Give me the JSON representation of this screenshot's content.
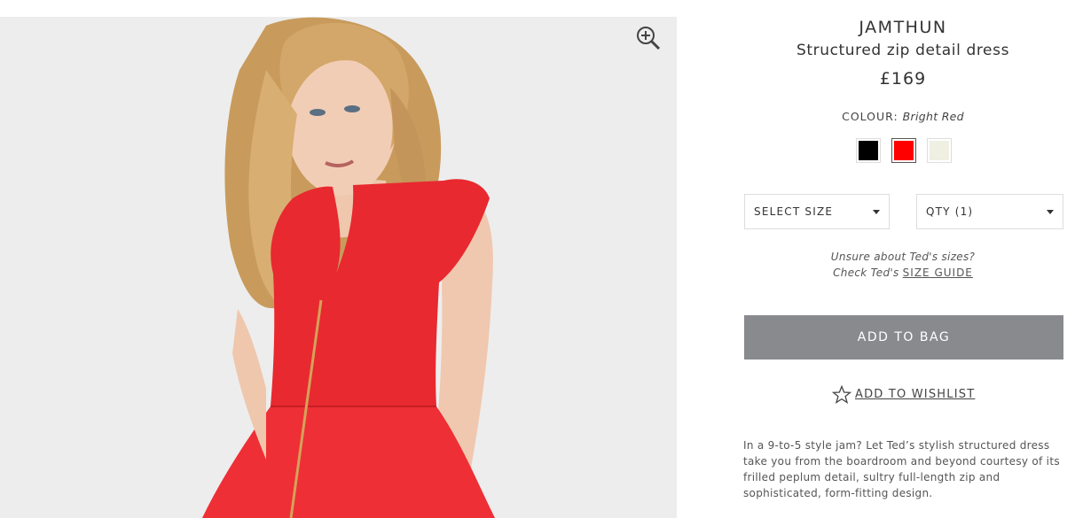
{
  "product": {
    "brand": "JAMTHUN",
    "name": "Structured zip detail dress",
    "price": "£169"
  },
  "colour": {
    "label": "COLOUR:",
    "selected": "Bright Red",
    "swatches": [
      {
        "name": "Black",
        "color": "#000000",
        "selected": false
      },
      {
        "name": "Bright Red",
        "color": "#ff0000",
        "selected": true
      },
      {
        "name": "Ivory",
        "color": "#efefe2",
        "selected": false
      }
    ]
  },
  "selectors": {
    "size_label": "SELECT SIZE",
    "qty_label": "QTY (1)"
  },
  "size_help": {
    "line1": "Unsure about Ted's sizes?",
    "line2_prefix": "Check Ted's",
    "guide_link": "SIZE GUIDE"
  },
  "actions": {
    "add_to_bag": "ADD TO BAG",
    "add_to_wishlist": "ADD TO WISHLIST"
  },
  "description": "In a 9-to-5 style jam? Let Ted’s stylish structured dress take you from the boardroom and beyond courtesy of its frilled peplum detail, sultry full-length zip and sophisticated, form-fitting design.",
  "icons": {
    "zoom": "zoom-in-icon",
    "wishlist": "star-outline-icon",
    "dropdown": "chevron-down-icon"
  },
  "colors": {
    "button_bg": "#898a8d",
    "image_bg": "#ededed",
    "dress_red": "#e62a2f"
  }
}
